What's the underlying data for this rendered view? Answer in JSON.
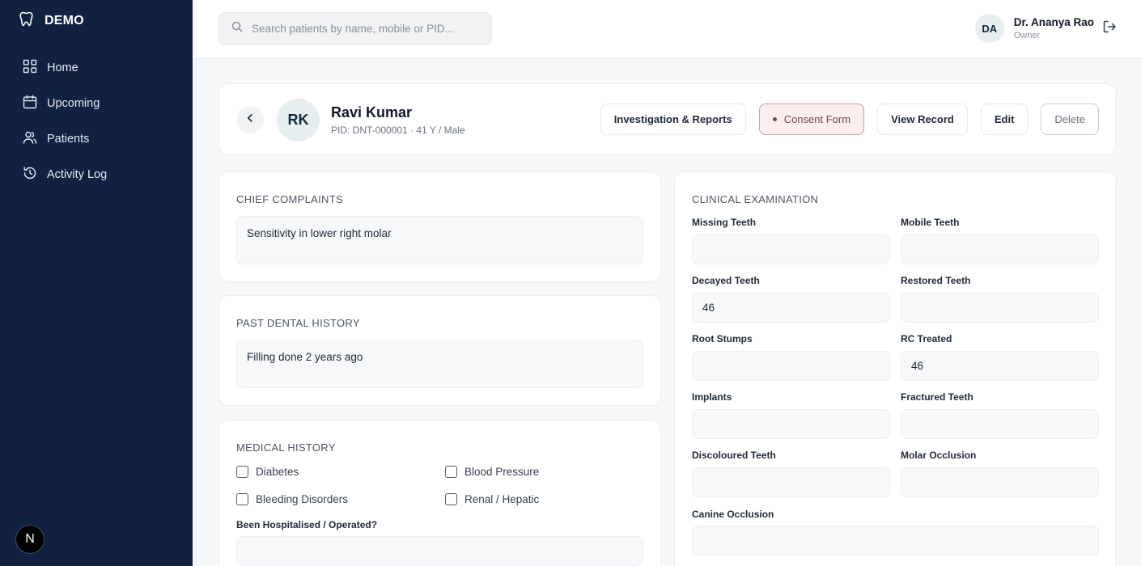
{
  "sidebar": {
    "brand": "DEMO",
    "items": [
      {
        "label": "Home",
        "icon": "grid-icon"
      },
      {
        "label": "Upcoming",
        "icon": "calendar-icon"
      },
      {
        "label": "Patients",
        "icon": "users-icon"
      },
      {
        "label": "Activity Log",
        "icon": "history-icon"
      }
    ],
    "bottom_badge": "N"
  },
  "topbar": {
    "search_placeholder": "Search patients by name, mobile or PID...",
    "user": {
      "initials": "DA",
      "name": "Dr. Ananya Rao",
      "role": "Owner"
    }
  },
  "patient": {
    "initials": "RK",
    "name": "Ravi Kumar",
    "meta": "PID: DNT-000001 · 41 Y / Male"
  },
  "actions": {
    "investigation": "Investigation & Reports",
    "consent": "Consent Form",
    "view_record": "View Record",
    "edit": "Edit",
    "delete": "Delete"
  },
  "chief": {
    "title": "CHIEF COMPLAINTS",
    "value": "Sensitivity in lower right molar"
  },
  "past": {
    "title": "PAST DENTAL HISTORY",
    "value": "Filling done 2 years ago"
  },
  "medical": {
    "title": "MEDICAL HISTORY",
    "checks": [
      "Diabetes",
      "Blood Pressure",
      "Bleeding Disorders",
      "Renal / Hepatic"
    ],
    "hospitalised_label": "Been Hospitalised / Operated?",
    "hospitalised_value": ""
  },
  "clinical": {
    "title": "CLINICAL EXAMINATION",
    "fields": [
      {
        "label": "Missing Teeth",
        "value": ""
      },
      {
        "label": "Mobile Teeth",
        "value": ""
      },
      {
        "label": "Decayed Teeth",
        "value": "46"
      },
      {
        "label": "Restored Teeth",
        "value": ""
      },
      {
        "label": "Root Stumps",
        "value": ""
      },
      {
        "label": "RC Treated",
        "value": "46"
      },
      {
        "label": "Implants",
        "value": ""
      },
      {
        "label": "Fractured Teeth",
        "value": ""
      },
      {
        "label": "Discoloured Teeth",
        "value": ""
      },
      {
        "label": "Molar Occlusion",
        "value": ""
      },
      {
        "label": "Canine Occlusion",
        "value": ""
      }
    ]
  },
  "colors": {
    "sidebar": "#112240",
    "consent_bg": "#fbeeee",
    "consent_border": "#c9a1a1"
  }
}
